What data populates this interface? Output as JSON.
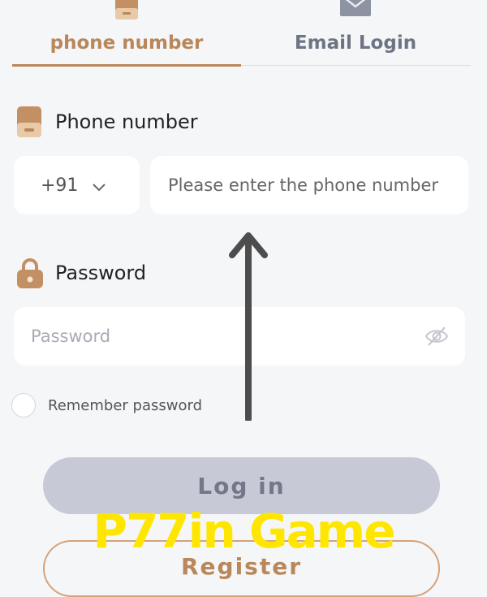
{
  "tabs": [
    {
      "label": "phone number",
      "icon": "phone-icon",
      "active": true
    },
    {
      "label": "Email Login",
      "icon": "envelope-icon",
      "active": false
    }
  ],
  "phone_section": {
    "label": "Phone number",
    "icon": "phone-icon",
    "country_code": "+91",
    "placeholder": "Please enter the phone number"
  },
  "password_section": {
    "label": "Password",
    "icon": "lock-icon",
    "placeholder": "Password"
  },
  "remember": {
    "label": "Remember password",
    "checked": false
  },
  "buttons": {
    "login": "Log in",
    "register": "Register"
  },
  "watermark": "P77in Game",
  "colors": {
    "accent": "#b8875a",
    "login_bg": "#c7c9d7",
    "login_text": "#747789",
    "watermark": "#ffe600",
    "background": "#f5f6f8"
  }
}
